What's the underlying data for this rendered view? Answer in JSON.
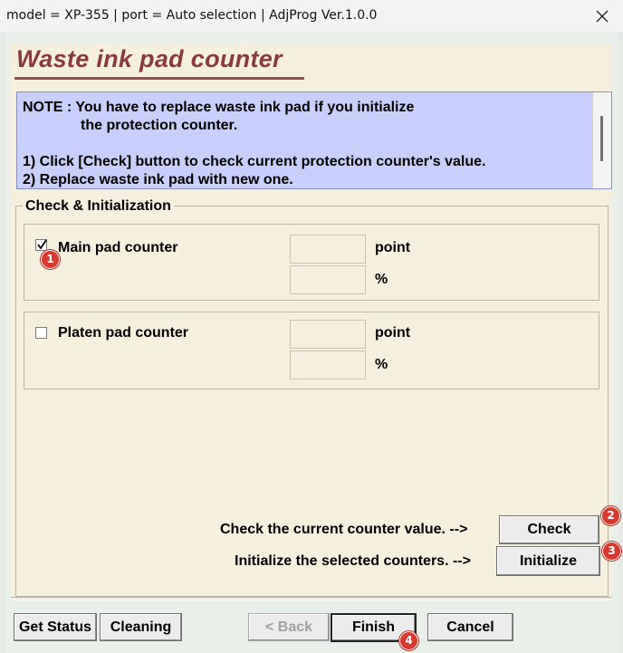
{
  "window": {
    "title": "model = XP-355 | port = Auto selection | AdjProg Ver.1.0.0",
    "close_glyph": "✕"
  },
  "page": {
    "title": "Waste ink pad counter"
  },
  "note": {
    "line1": "NOTE : You have to replace waste ink pad if you initialize",
    "line2": "the protection counter.",
    "line3": "1) Click [Check] button to check current protection counter's value.",
    "line4": "2) Replace waste ink pad with new one."
  },
  "group": {
    "legend": "Check & Initialization"
  },
  "main_pad": {
    "label": "Main pad counter",
    "checked": true,
    "point_value": "",
    "percent_value": "",
    "point_unit": "point",
    "percent_unit": "%"
  },
  "platen_pad": {
    "label": "Platen pad counter",
    "checked": false,
    "point_value": "",
    "percent_value": "",
    "point_unit": "point",
    "percent_unit": "%"
  },
  "actions": {
    "check_text": "Check the current counter value. -->",
    "check_label": "Check",
    "init_text": "Initialize the selected counters. -->",
    "init_label": "Initialize"
  },
  "footer": {
    "get_status_label": "Get Status",
    "cleaning_label": "Cleaning",
    "back_label": "< Back",
    "finish_label": "Finish",
    "cancel_label": "Cancel"
  },
  "badges": {
    "b1": "1",
    "b2": "2",
    "b3": "3",
    "b4": "4"
  },
  "colors": {
    "title_text": "#8b3a3a",
    "note_bg": "#c8cffa",
    "panel_bg": "#f5efde",
    "window_bg": "#e9efe9",
    "badge_red": "#d63a2f"
  }
}
